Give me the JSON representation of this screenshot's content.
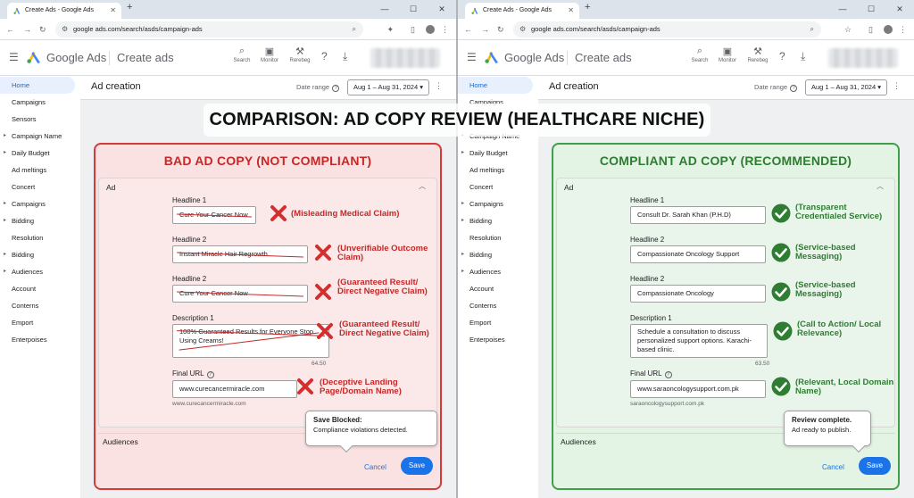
{
  "banner": "COMPARISON: AD COPY REVIEW (HEALTHCARE NICHE)",
  "colors": {
    "bad": "#c62828",
    "good": "#2e7d32",
    "accent": "#1a73e8"
  },
  "browser": {
    "tab_title": "Create Ads - Google Ads",
    "new_tab": "+",
    "url": "google ads.com/search/asds/campaign-ads",
    "controls": {
      "minimize": "—",
      "maximize": "☐",
      "close": "✕"
    }
  },
  "app": {
    "brand": "Google Ads",
    "page": "Create ads",
    "tools": [
      {
        "icon": "search-icon",
        "label": "Search"
      },
      {
        "icon": "monitor-icon",
        "label": "Monitor"
      },
      {
        "icon": "tools-icon",
        "label": "Rerebeg"
      }
    ]
  },
  "sidebar": {
    "items": [
      {
        "label": "Home",
        "caret": false
      },
      {
        "label": "Campaigns",
        "caret": false
      },
      {
        "label": "Sensors",
        "caret": false
      },
      {
        "label": "Campaign Name",
        "caret": true
      },
      {
        "label": "Daily Budget",
        "caret": true
      },
      {
        "label": "Ad meltings",
        "caret": false
      },
      {
        "label": "Concert",
        "caret": false
      },
      {
        "label": "Campaigns",
        "caret": true
      },
      {
        "label": "Bidding",
        "caret": true
      },
      {
        "label": "Resolution",
        "caret": false
      },
      {
        "label": "Bidding",
        "caret": true
      },
      {
        "label": "Audiences",
        "caret": true
      },
      {
        "label": "Account",
        "caret": false
      },
      {
        "label": "Conterns",
        "caret": false
      },
      {
        "label": "Emport",
        "caret": false
      },
      {
        "label": "Enterpoises",
        "caret": false
      }
    ]
  },
  "header": {
    "title": "Ad creation",
    "date_label": "Date range",
    "date_value": "Aug 1 – Aug 31, 2024"
  },
  "left": {
    "title": "BAD AD COPY (NOT COMPLIANT)",
    "card_title": "Ad",
    "fields": [
      {
        "label": "Headline 1",
        "value": "Cure Your Cancer Now",
        "note": "(Misleading Medical Claim)"
      },
      {
        "label": "Headline 2",
        "value": "Instant Miracle Hair Regrowth",
        "note": "(Unverifiable Outcome Claim)"
      },
      {
        "label": "Headline 2",
        "value": "Cure Your Cancer Now",
        "note": "(Guaranteed Result/ Direct Negative Claim)"
      },
      {
        "label": "Description 1",
        "value": "100% Guaranteed Results for Everyone Stop Using Creams!",
        "note": "(Guaranteed Result/ Direct Negative Claim)",
        "count": "64.50"
      },
      {
        "label": "Final URL",
        "value": "www.curecancermiracle.com",
        "note": "(Deceptive Landing Page/Domain Name)",
        "caption": "www.curecancermiracle.com"
      }
    ],
    "audiences": "Audiences",
    "popup_title": "Save Blocked:",
    "popup_text": "Compliance violations detected.",
    "cancel": "Cancel",
    "save": "Save"
  },
  "right": {
    "title": "COMPLIANT AD COPY (RECOMMENDED)",
    "card_title": "Ad",
    "fields": [
      {
        "label": "Headline 1",
        "value": "Consult Dr. Sarah Khan (P.H.D)",
        "note": "(Transparent Credentialed Service)"
      },
      {
        "label": "Headline 2",
        "value": "Compassionate Oncology Support",
        "note": "(Service-based Messaging)"
      },
      {
        "label": "Headline 2",
        "value": "Compassionate Oncology",
        "note": "(Service-based Messaging)"
      },
      {
        "label": "Description 1",
        "value": "Schedule a consultation to discuss personalized support options. Karachi-based clinic.",
        "note": "(Call to Action/ Local Relevance)",
        "count": "63.50"
      },
      {
        "label": "Final URL",
        "value": "www.saraoncologysupport.com.pk",
        "note": "(Relevant, Local Domain Name)",
        "caption": "saraoncologysupport.com.pk"
      }
    ],
    "audiences": "Audiences",
    "popup_title": "Review complete.",
    "popup_text": "Ad ready to publish.",
    "cancel": "Cancel",
    "save": "Save"
  }
}
